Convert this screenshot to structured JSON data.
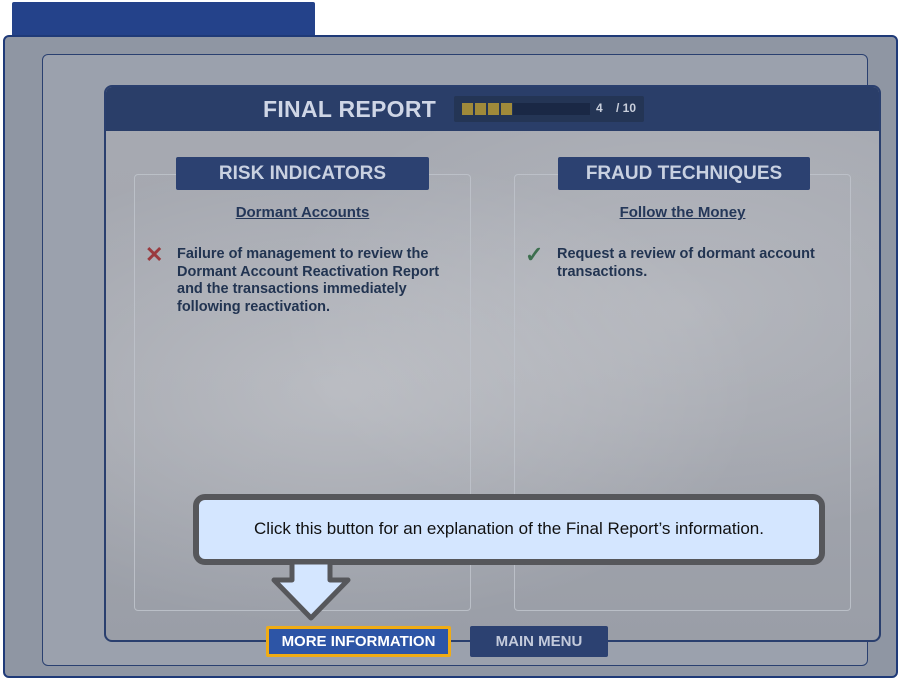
{
  "report": {
    "title": "FINAL REPORT",
    "progress_current": "4",
    "progress_total": "/ 10",
    "progress_fraction": 0.4
  },
  "columns": {
    "left": {
      "heading": "RISK INDICATORS",
      "subheading": "Dormant Accounts",
      "item_icon": "x-mark-icon",
      "item_text": "Failure of management to review the Dormant Account Reactivation Report and the transactions immediately following reactivation."
    },
    "right": {
      "heading": "FRAUD TECHNIQUES",
      "subheading": "Follow the Money",
      "item_icon": "check-mark-icon",
      "item_text": "Request a review of dormant account transactions."
    }
  },
  "buttons": {
    "more_info": "MORE INFORMATION",
    "main_menu": "MAIN MENU"
  },
  "callout": {
    "text": "Click this button for an explanation of the Final Report’s information."
  },
  "colors": {
    "accent_highlight": "#f0ac14",
    "header_navy": "#2a3e69",
    "callout_bg": "#d4e6ff",
    "cross": "#9a3a3e",
    "check": "#3d6f4f"
  }
}
